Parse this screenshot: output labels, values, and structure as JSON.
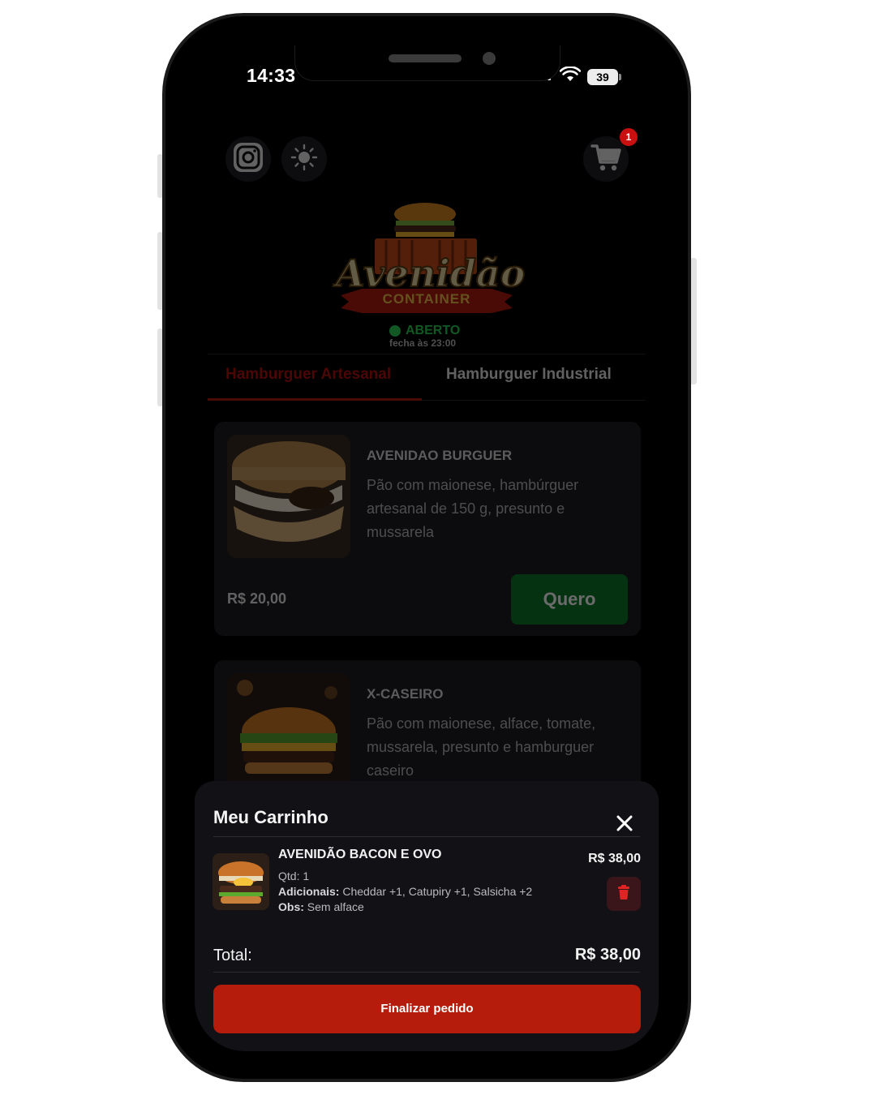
{
  "status_bar": {
    "time": "14:33",
    "battery": "39"
  },
  "header": {
    "instagram_icon": "instagram-icon",
    "theme_icon": "theme-toggle-icon",
    "cart_icon": "cart-icon",
    "cart_count": "1"
  },
  "brand": {
    "name": "Avenidão",
    "sub": "CONTAINER"
  },
  "store_status": {
    "state": "ABERTO",
    "closes": "fecha às 23:00"
  },
  "tabs": [
    {
      "label": "Hamburguer Artesanal",
      "active": true
    },
    {
      "label": "Hamburguer Industrial",
      "active": false
    }
  ],
  "products": [
    {
      "title": "AVENIDAO BURGUER",
      "description": "Pão com maionese, hambúrguer artesanal de 150 g, presunto e mussarela",
      "price": "R$ 20,00",
      "button": "Quero"
    },
    {
      "title": "X-CASEIRO",
      "description": "Pão com maionese, alface, tomate, mussarela, presunto e hamburguer caseiro"
    }
  ],
  "cart": {
    "title": "Meu Carrinho",
    "item": {
      "name": "AVENIDÃO BACON E OVO",
      "qty": "Qtd: 1",
      "additions_label": "Adicionais:",
      "additions": " Cheddar +1, Catupiry +1, Salsicha +2",
      "obs_label": "Obs:",
      "obs": " Sem alface",
      "price": "R$ 38,00"
    },
    "total_label": "Total:",
    "total_value": "R$ 38,00",
    "finish_button": "Finalizar pedido"
  },
  "colors": {
    "accent_red": "#b51c0b",
    "open_green": "#2ad158",
    "button_green": "#0e7a2b",
    "sheet_bg": "#121216"
  }
}
